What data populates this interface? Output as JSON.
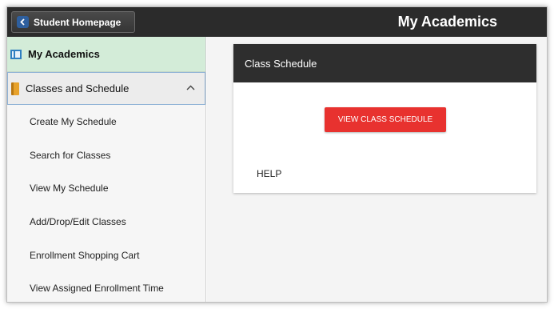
{
  "header": {
    "back_button_label": "Student Homepage",
    "page_title": "My Academics"
  },
  "sidebar": {
    "top_item": {
      "label": "My Academics",
      "icon": "academics-icon"
    },
    "group": {
      "label": "Classes and Schedule",
      "icon": "book-icon",
      "expanded": true
    },
    "items": [
      {
        "label": "Create My Schedule"
      },
      {
        "label": "Search for Classes"
      },
      {
        "label": "View My Schedule"
      },
      {
        "label": "Add/Drop/Edit Classes"
      },
      {
        "label": "Enrollment Shopping Cart"
      },
      {
        "label": "View Assigned Enrollment Time"
      }
    ]
  },
  "main": {
    "card": {
      "title": "Class Schedule",
      "button_label": "VIEW CLASS SCHEDULE",
      "help_label": "HELP"
    }
  },
  "colors": {
    "header_bg": "#2b2b2b",
    "selected_bg": "#d3ecd8",
    "button_red": "#e8322f"
  }
}
